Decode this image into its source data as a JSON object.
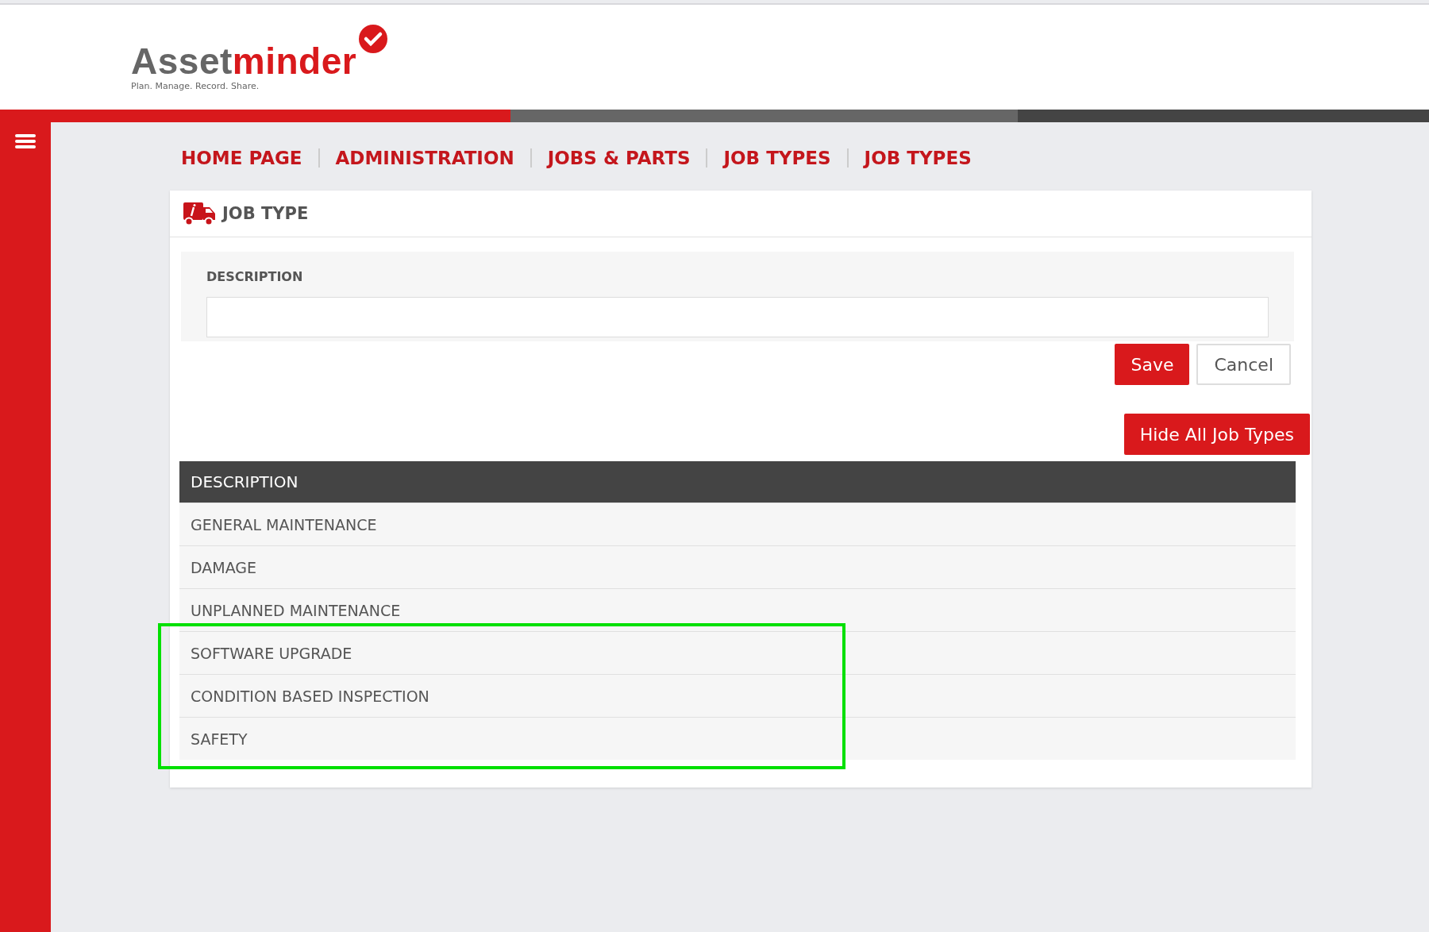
{
  "logo": {
    "name_part_1": "Asset",
    "name_part_2": "minder",
    "tagline": "Plan. Manage. Record. Share."
  },
  "breadcrumb": [
    {
      "label": "HOME PAGE"
    },
    {
      "label": "ADMINISTRATION"
    },
    {
      "label": "JOBS & PARTS"
    },
    {
      "label": "JOB TYPES"
    },
    {
      "label": "JOB TYPES"
    }
  ],
  "card": {
    "title": "JOB TYPE",
    "form": {
      "label": "DESCRIPTION",
      "buttons": [
        {
          "label": "Save",
          "kind": "primary"
        },
        {
          "label": "Cancel",
          "kind": "secondary"
        }
      ]
    },
    "toggle_button": "Hide All Job Types",
    "table": {
      "columns": [
        "DESCRIPTION"
      ],
      "rows": [
        {
          "description": "GENERAL MAINTENANCE"
        },
        {
          "description": "DAMAGE"
        },
        {
          "description": "UNPLANNED MAINTENANCE"
        }
      ],
      "highlighted_rows": [
        {
          "description": "SOFTWARE UPGRADE"
        },
        {
          "description": "CONDITION BASED INSPECTION"
        },
        {
          "description": "SAFETY"
        }
      ]
    }
  }
}
